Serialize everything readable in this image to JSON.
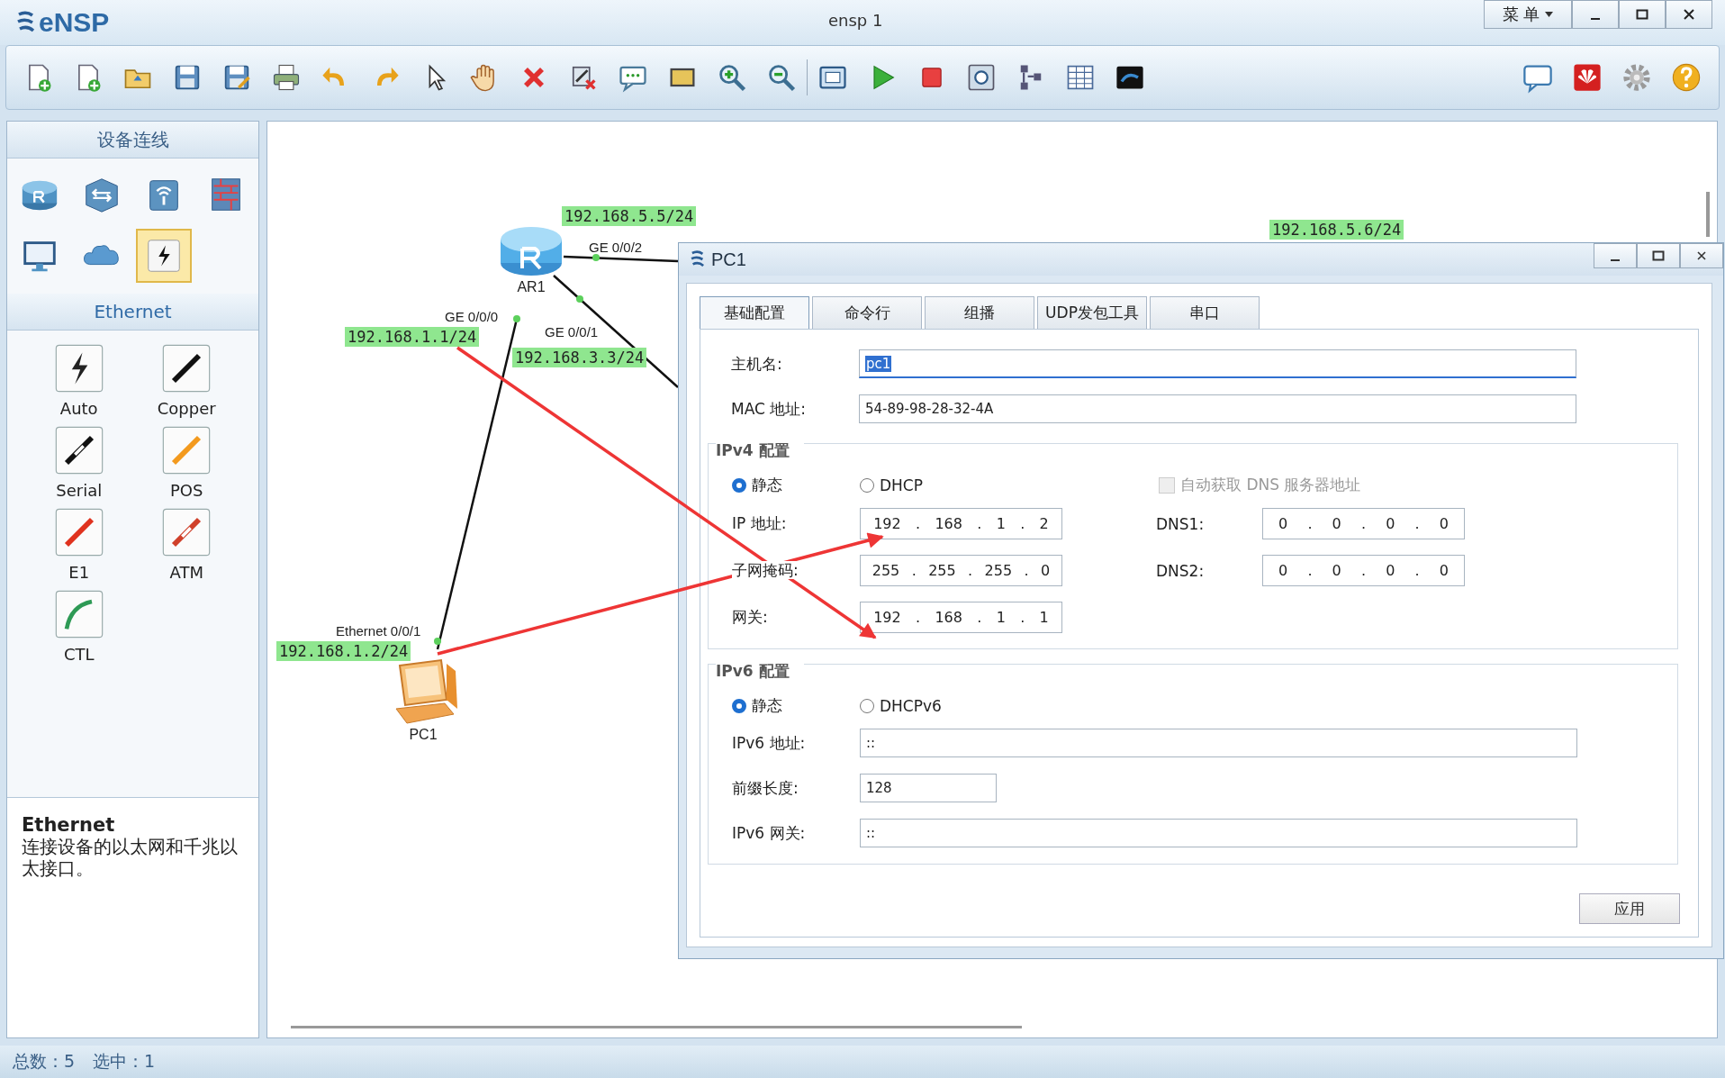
{
  "window": {
    "title": "eNSP",
    "subtitle": "ensp  1",
    "menu": "菜 单"
  },
  "device_panel": {
    "title": "设备连线",
    "categories": [
      {
        "kind": "router",
        "selected": false
      },
      {
        "kind": "switch",
        "selected": false
      },
      {
        "kind": "wireless",
        "selected": false
      },
      {
        "kind": "firewall",
        "selected": false
      },
      {
        "kind": "pc",
        "selected": false
      },
      {
        "kind": "cloud",
        "selected": false
      },
      {
        "kind": "cable",
        "selected": true
      }
    ],
    "section_title": "Ethernet",
    "cables": [
      {
        "label": "Auto",
        "kind": "auto"
      },
      {
        "label": "Copper",
        "kind": "copper"
      },
      {
        "label": "Serial",
        "kind": "serial"
      },
      {
        "label": "POS",
        "kind": "pos"
      },
      {
        "label": "E1",
        "kind": "e1"
      },
      {
        "label": "ATM",
        "kind": "atm"
      },
      {
        "label": "CTL",
        "kind": "ctl"
      }
    ],
    "description": {
      "title": "Ethernet",
      "text": "连接设备的以太网和千兆以太接口。"
    }
  },
  "topology": {
    "nodes": [
      {
        "label": "AR1",
        "kind": "router"
      },
      {
        "label": "PC1",
        "kind": "pc"
      }
    ],
    "port_labels": [
      "GE 0/0/2",
      "GE 0/0/0",
      "GE 0/0/1",
      "Ethernet 0/0/1"
    ],
    "ip_labels": [
      "192.168.5.5/24",
      "192.168.1.1/24",
      "192.168.3.3/24",
      "192.168.5.6/24",
      "192.168.1.2/24"
    ]
  },
  "dialog": {
    "title": "PC1",
    "tabs": [
      {
        "label": "基础配置",
        "selected": true
      },
      {
        "label": "命令行",
        "selected": false
      },
      {
        "label": "组播",
        "selected": false
      },
      {
        "label": "UDP发包工具",
        "selected": false
      },
      {
        "label": "串口",
        "selected": false
      }
    ],
    "hostname": {
      "label": "主机名:",
      "value": "pc1"
    },
    "mac": {
      "label": "MAC 地址:",
      "value": "54-89-98-28-32-4A"
    },
    "ipv4": {
      "title": "IPv4 配置",
      "separator": ".",
      "modes": [
        {
          "label": "静态",
          "selected": true
        },
        {
          "label": "DHCP",
          "selected": false
        }
      ],
      "auto_dns": {
        "label": "自动获取 DNS 服务器地址",
        "checked": false,
        "disabled": true
      },
      "fields": [
        {
          "label": "IP 地址:",
          "octets": [
            "192",
            "168",
            "1",
            "2"
          ]
        },
        {
          "label": "子网掩码:",
          "octets": [
            "255",
            "255",
            "255",
            "0"
          ]
        },
        {
          "label": "网关:",
          "octets": [
            "192",
            "168",
            "1",
            "1"
          ]
        }
      ],
      "dns": [
        {
          "label": "DNS1:",
          "octets": [
            "0",
            "0",
            "0",
            "0"
          ]
        },
        {
          "label": "DNS2:",
          "octets": [
            "0",
            "0",
            "0",
            "0"
          ]
        }
      ]
    },
    "ipv6": {
      "title": "IPv6 配置",
      "modes": [
        {
          "label": "静态",
          "selected": true
        },
        {
          "label": "DHCPv6",
          "selected": false
        }
      ],
      "address": {
        "label": "IPv6 地址:",
        "value": "::"
      },
      "prefix": {
        "label": "前缀长度:",
        "value": "128"
      },
      "gateway": {
        "label": "IPv6 网关:",
        "value": "::"
      }
    },
    "apply": "应用"
  },
  "status_bar": {
    "total": "总数：5",
    "selected": "选中：1"
  }
}
